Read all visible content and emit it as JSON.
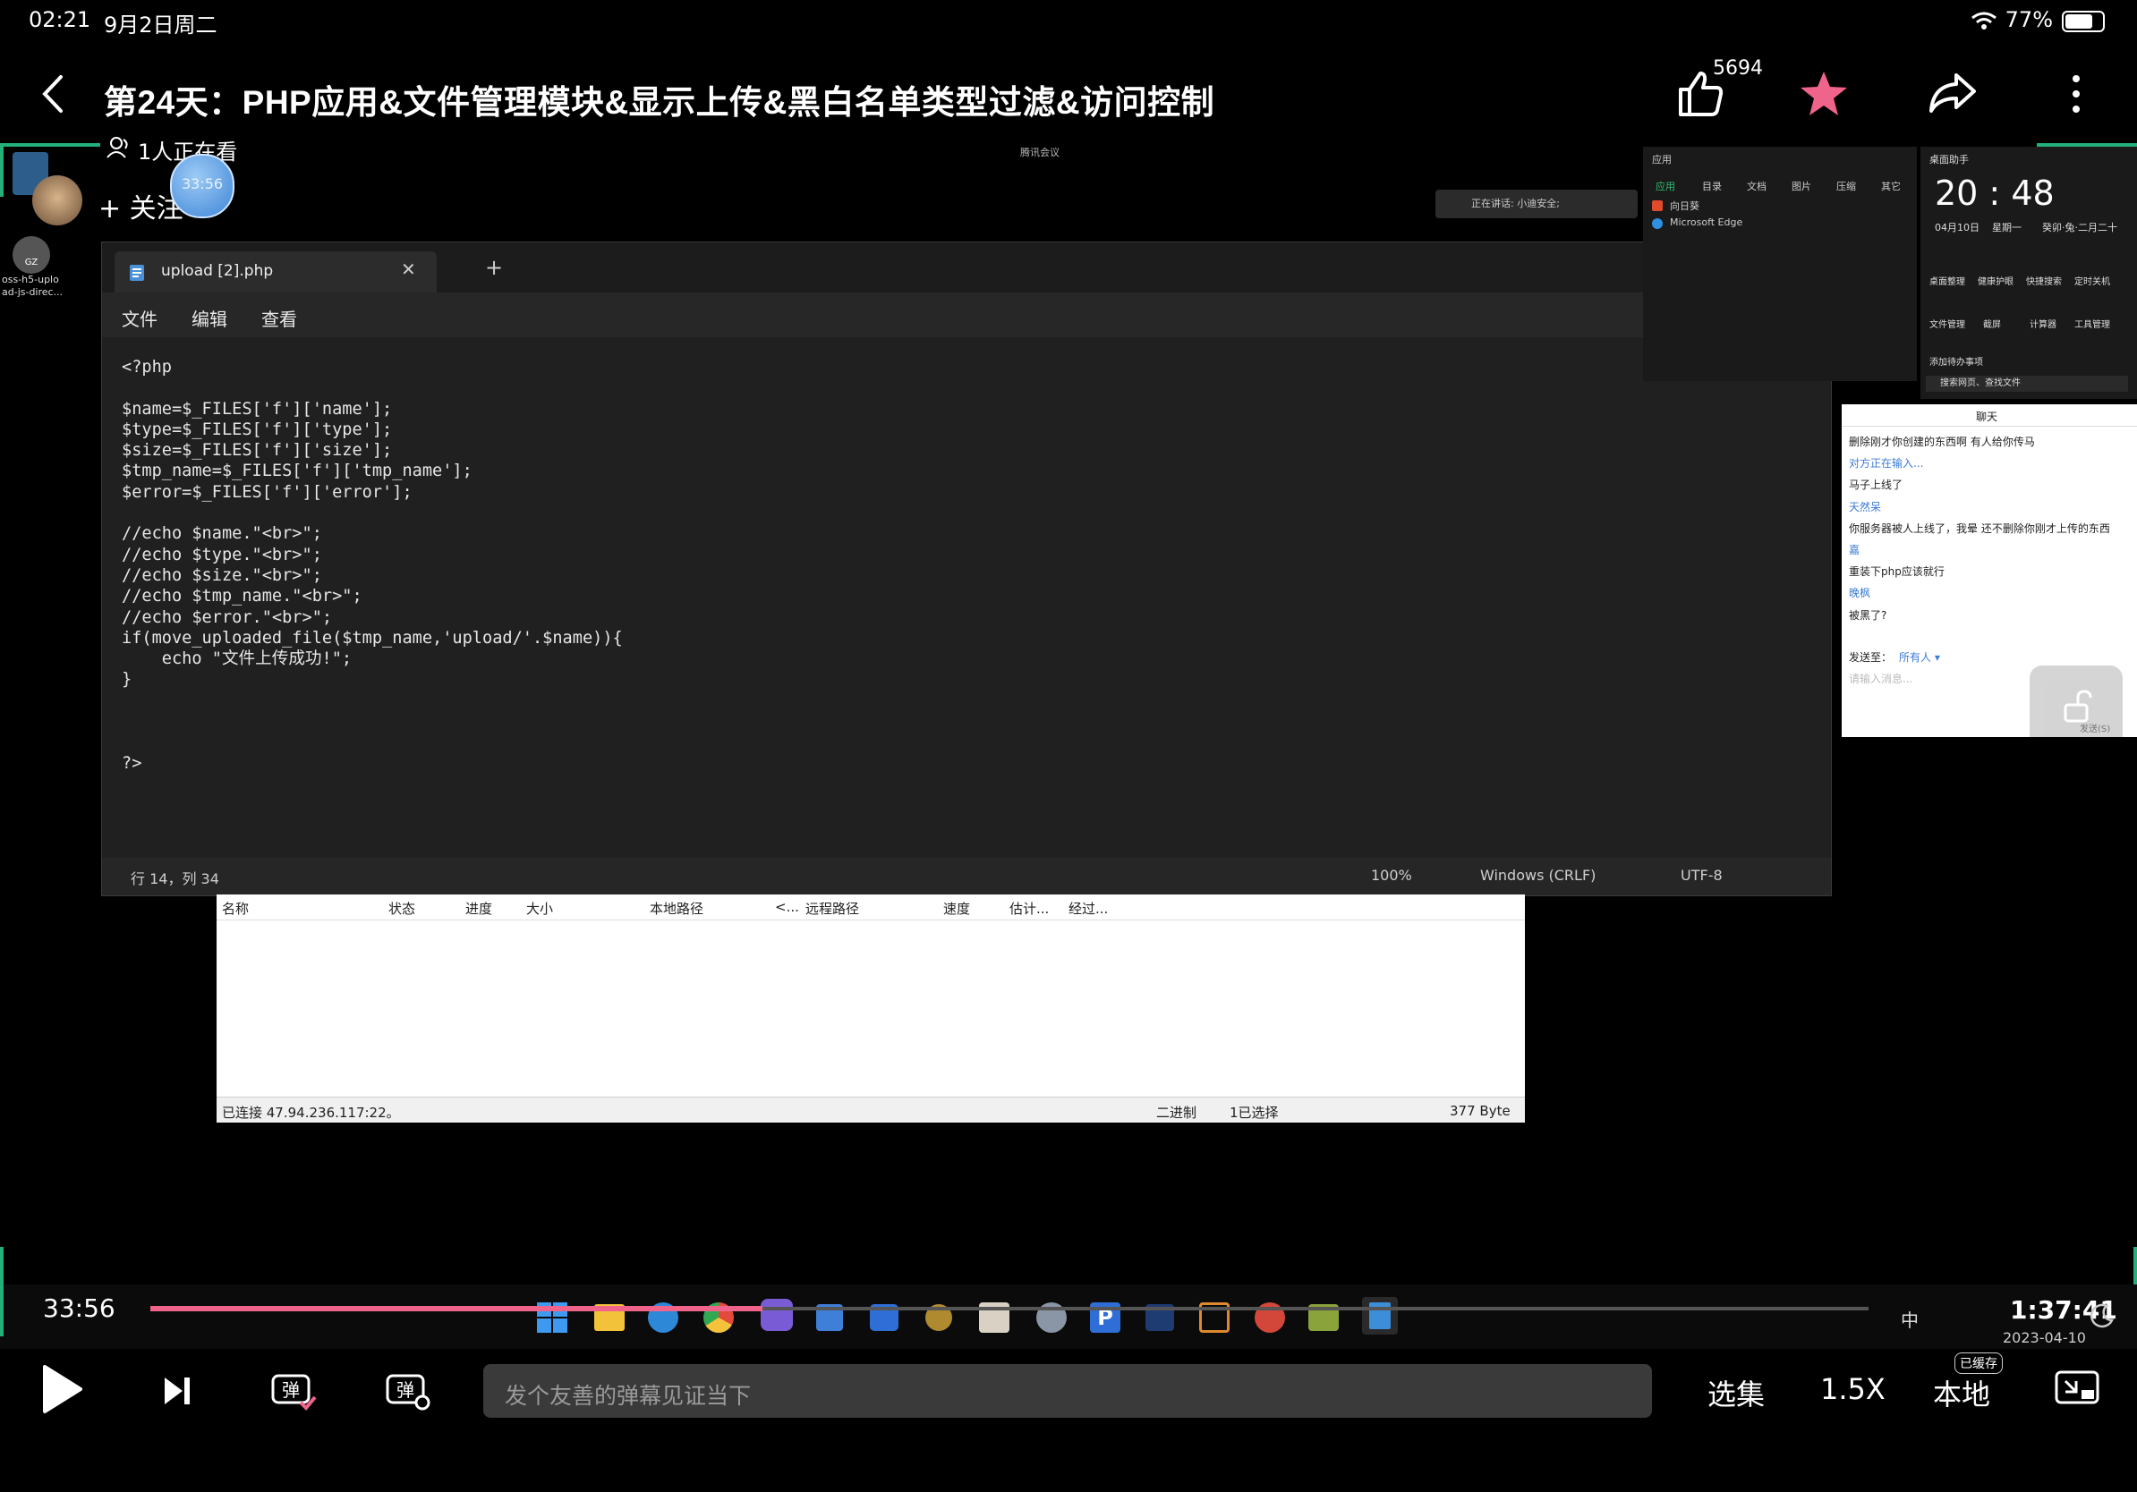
{
  "status_bar": {
    "time": "02:21",
    "date": "9月2日周二",
    "battery": "77%"
  },
  "header": {
    "title": "第24天：PHP应用&文件管理模块&显示上传&黑白名单类型过滤&访问控制",
    "like_count": "5694"
  },
  "overlay": {
    "watching": "1人正在看",
    "follow": "+ 关注",
    "bubble_time": "33:56"
  },
  "desktop": {
    "file_label": "oss-h5-upload-js-direc...",
    "avatar_label": "GZ"
  },
  "meeting_bar": {
    "label": "腾讯会议",
    "speaking": "正在讲话: 小迪安全;"
  },
  "notepad": {
    "tab_title": "upload [2].php",
    "menu": [
      "文件",
      "编辑",
      "查看"
    ],
    "code": "<?php\n\n$name=$_FILES['f']['name'];\n$type=$_FILES['f']['type'];\n$size=$_FILES['f']['size'];\n$tmp_name=$_FILES['f']['tmp_name'];\n$error=$_FILES['f']['error'];\n\n//echo $name.\"<br>\";\n//echo $type.\"<br>\";\n//echo $size.\"<br>\";\n//echo $tmp_name.\"<br>\";\n//echo $error.\"<br>\";\nif(move_uploaded_file($tmp_name,'upload/'.$name)){\n    echo \"文件上传成功!\";\n}\n\n\n\n?>",
    "status": {
      "position": "行 14，列 34",
      "zoom": "100%",
      "line_ending": "Windows (CRLF)",
      "encoding": "UTF-8"
    }
  },
  "ftp": {
    "columns": [
      "名称",
      "状态",
      "进度",
      "大小",
      "本地路径",
      "<...",
      "远程路径",
      "速度",
      "估计...",
      "经过..."
    ],
    "status_left": "已连接 47.94.236.117:22。",
    "status_mode": "二进制",
    "status_selected": "1已选择",
    "status_size": "377 Byte"
  },
  "start_menu": {
    "title": "应用",
    "tabs": [
      "应用",
      "目录",
      "文档",
      "图片",
      "压缩",
      "其它"
    ],
    "items": [
      "向日葵",
      "Microsoft Edge"
    ]
  },
  "clock_panel": {
    "title": "桌面助手",
    "time": "20 : 48",
    "date": "04月10日",
    "weekday": "星期一",
    "lunar": "癸卯·兔·二月二十",
    "tools": [
      "桌面整理",
      "健康护眼",
      "快捷搜索",
      "定时关机",
      "文件管理",
      "截屏",
      "计算器",
      "工具管理"
    ],
    "add_todo": "添加待办事项",
    "search_placeholder": "搜索网页、查找文件"
  },
  "chat": {
    "title": "聊天",
    "messages": [
      {
        "text": "删除刚才你创建的东西啊  有人给你传马",
        "color": "#222222"
      },
      {
        "text": "对方正在输入...",
        "color": "#3b7bd6"
      },
      {
        "text": "马子上线了",
        "color": "#222222"
      },
      {
        "text": "天然呆",
        "color": "#3b7bd6"
      },
      {
        "text": "你服务器被人上线了，我晕  还不删除你刚才上传的东西",
        "color": "#222222"
      },
      {
        "text": "嘉",
        "color": "#3b7bd6"
      },
      {
        "text": "重装下php应该就行",
        "color": "#222222"
      },
      {
        "text": "晚枫",
        "color": "#3b7bd6"
      },
      {
        "text": "被黑了?",
        "color": "#222222"
      }
    ],
    "send_to_label": "发送至：",
    "send_to_value": "所有人 ▾",
    "input_placeholder": "请输入消息...",
    "send_label": "发送(S)"
  },
  "taskbar": {
    "lang": "中",
    "time": "1:37:41",
    "date": "2023-04-10"
  },
  "player": {
    "current_time": "33:56",
    "progress": 0.356,
    "danmaku_placeholder": "发个友善的弹幕见证当下",
    "episodes_label": "选集",
    "speed_label": "1.5X",
    "local_label": "本地",
    "cached_badge": "已缓存"
  },
  "colors": {
    "accent": "#f0648c",
    "star": "#f0648c",
    "green": "#24b07a"
  }
}
